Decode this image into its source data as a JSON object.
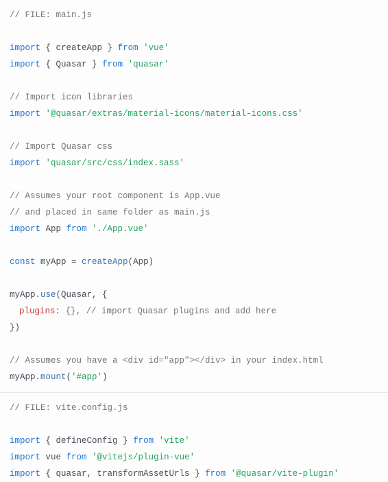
{
  "file1_header": "// FILE: main.js",
  "l1_import": "import",
  "l1_braces_open": " { ",
  "l1_name": "createApp",
  "l1_braces_close": " } ",
  "l1_from": "from",
  "l1_str": " 'vue'",
  "l2_import": "import",
  "l2_braces_open": " { ",
  "l2_name": "Quasar",
  "l2_braces_close": " } ",
  "l2_from": "from",
  "l2_str": " 'quasar'",
  "c1": "// Import icon libraries",
  "l3_import": "import",
  "l3_str": " '@quasar/extras/material-icons/material-icons.css'",
  "c2": "// Import Quasar css",
  "l4_import": "import",
  "l4_str": " 'quasar/src/css/index.sass'",
  "c3a": "// Assumes your root component is App.vue",
  "c3b": "// and placed in same folder as main.js",
  "l5_import": "import",
  "l5_name": " App ",
  "l5_from": "from",
  "l5_str": " './App.vue'",
  "l6_const": "const",
  "l6_name": " myApp ",
  "l6_eq": "= ",
  "l6_fn": "createApp",
  "l6_arg": "(App)",
  "l7_obj": "myApp.",
  "l7_fn": "use",
  "l7_args": "(Quasar, {",
  "l8_key": "plugins:",
  "l8_rest": " {}, // import Quasar plugins and add here",
  "l9_close": "})",
  "c4": "// Assumes you have a <div id=\"app\"></div> in your index.html",
  "l10_obj": "myApp.",
  "l10_fn": "mount",
  "l10_p1": "(",
  "l10_str": "'#app'",
  "l10_p2": ")",
  "file2_header": "// FILE: vite.config.js",
  "v1_import": "import",
  "v1_braces_open": " { ",
  "v1_name": "defineConfig",
  "v1_braces_close": " } ",
  "v1_from": "from",
  "v1_str": " 'vite'",
  "v2_import": "import",
  "v2_name": " vue ",
  "v2_from": "from",
  "v2_str": " '@vitejs/plugin-vue'",
  "v3_import": "import",
  "v3_braces_open": " { ",
  "v3_name": "quasar, transformAssetUrls",
  "v3_braces_close": " } ",
  "v3_from": "from",
  "v3_str": " '@quasar/vite-plugin'"
}
